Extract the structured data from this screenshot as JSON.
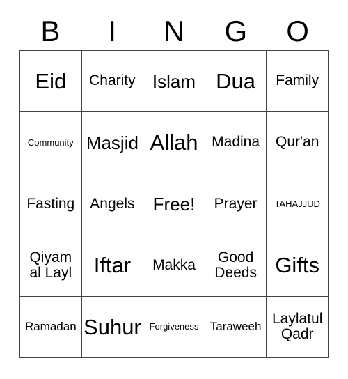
{
  "header": {
    "letters": [
      "B",
      "I",
      "N",
      "G",
      "O"
    ]
  },
  "grid": {
    "rows": 5,
    "columns": 5,
    "border_color": "#444444",
    "background_color": "#ffffff",
    "text_color": "#000000",
    "cells": [
      [
        {
          "label": "Eid",
          "size": "fs-xl"
        },
        {
          "label": "Charity",
          "size": "fs-md"
        },
        {
          "label": "Islam",
          "size": "fs-lg"
        },
        {
          "label": "Dua",
          "size": "fs-xl"
        },
        {
          "label": "Family",
          "size": "fs-md"
        }
      ],
      [
        {
          "label": "Community",
          "size": "fs-xs"
        },
        {
          "label": "Masjid",
          "size": "fs-lg"
        },
        {
          "label": "Allah",
          "size": "fs-xl"
        },
        {
          "label": "Madina",
          "size": "fs-md"
        },
        {
          "label": "Qur'an",
          "size": "fs-md"
        }
      ],
      [
        {
          "label": "Fasting",
          "size": "fs-md"
        },
        {
          "label": "Angels",
          "size": "fs-md"
        },
        {
          "label": "Free!",
          "size": "fs-lg"
        },
        {
          "label": "Prayer",
          "size": "fs-md"
        },
        {
          "label": "TAHAJJUD",
          "size": "fs-xs"
        }
      ],
      [
        {
          "label": "Qiyam\nal Layl",
          "size": "fs-md"
        },
        {
          "label": "Iftar",
          "size": "fs-xl"
        },
        {
          "label": "Makka",
          "size": "fs-md"
        },
        {
          "label": "Good\nDeeds",
          "size": "fs-md"
        },
        {
          "label": "Gifts",
          "size": "fs-xl"
        }
      ],
      [
        {
          "label": "Ramadan",
          "size": "fs-sm"
        },
        {
          "label": "Suhur",
          "size": "fs-xl"
        },
        {
          "label": "Forgiveness",
          "size": "fs-xs"
        },
        {
          "label": "Taraweeh",
          "size": "fs-sm"
        },
        {
          "label": "Laylatul\nQadr",
          "size": "fs-md"
        }
      ]
    ]
  }
}
